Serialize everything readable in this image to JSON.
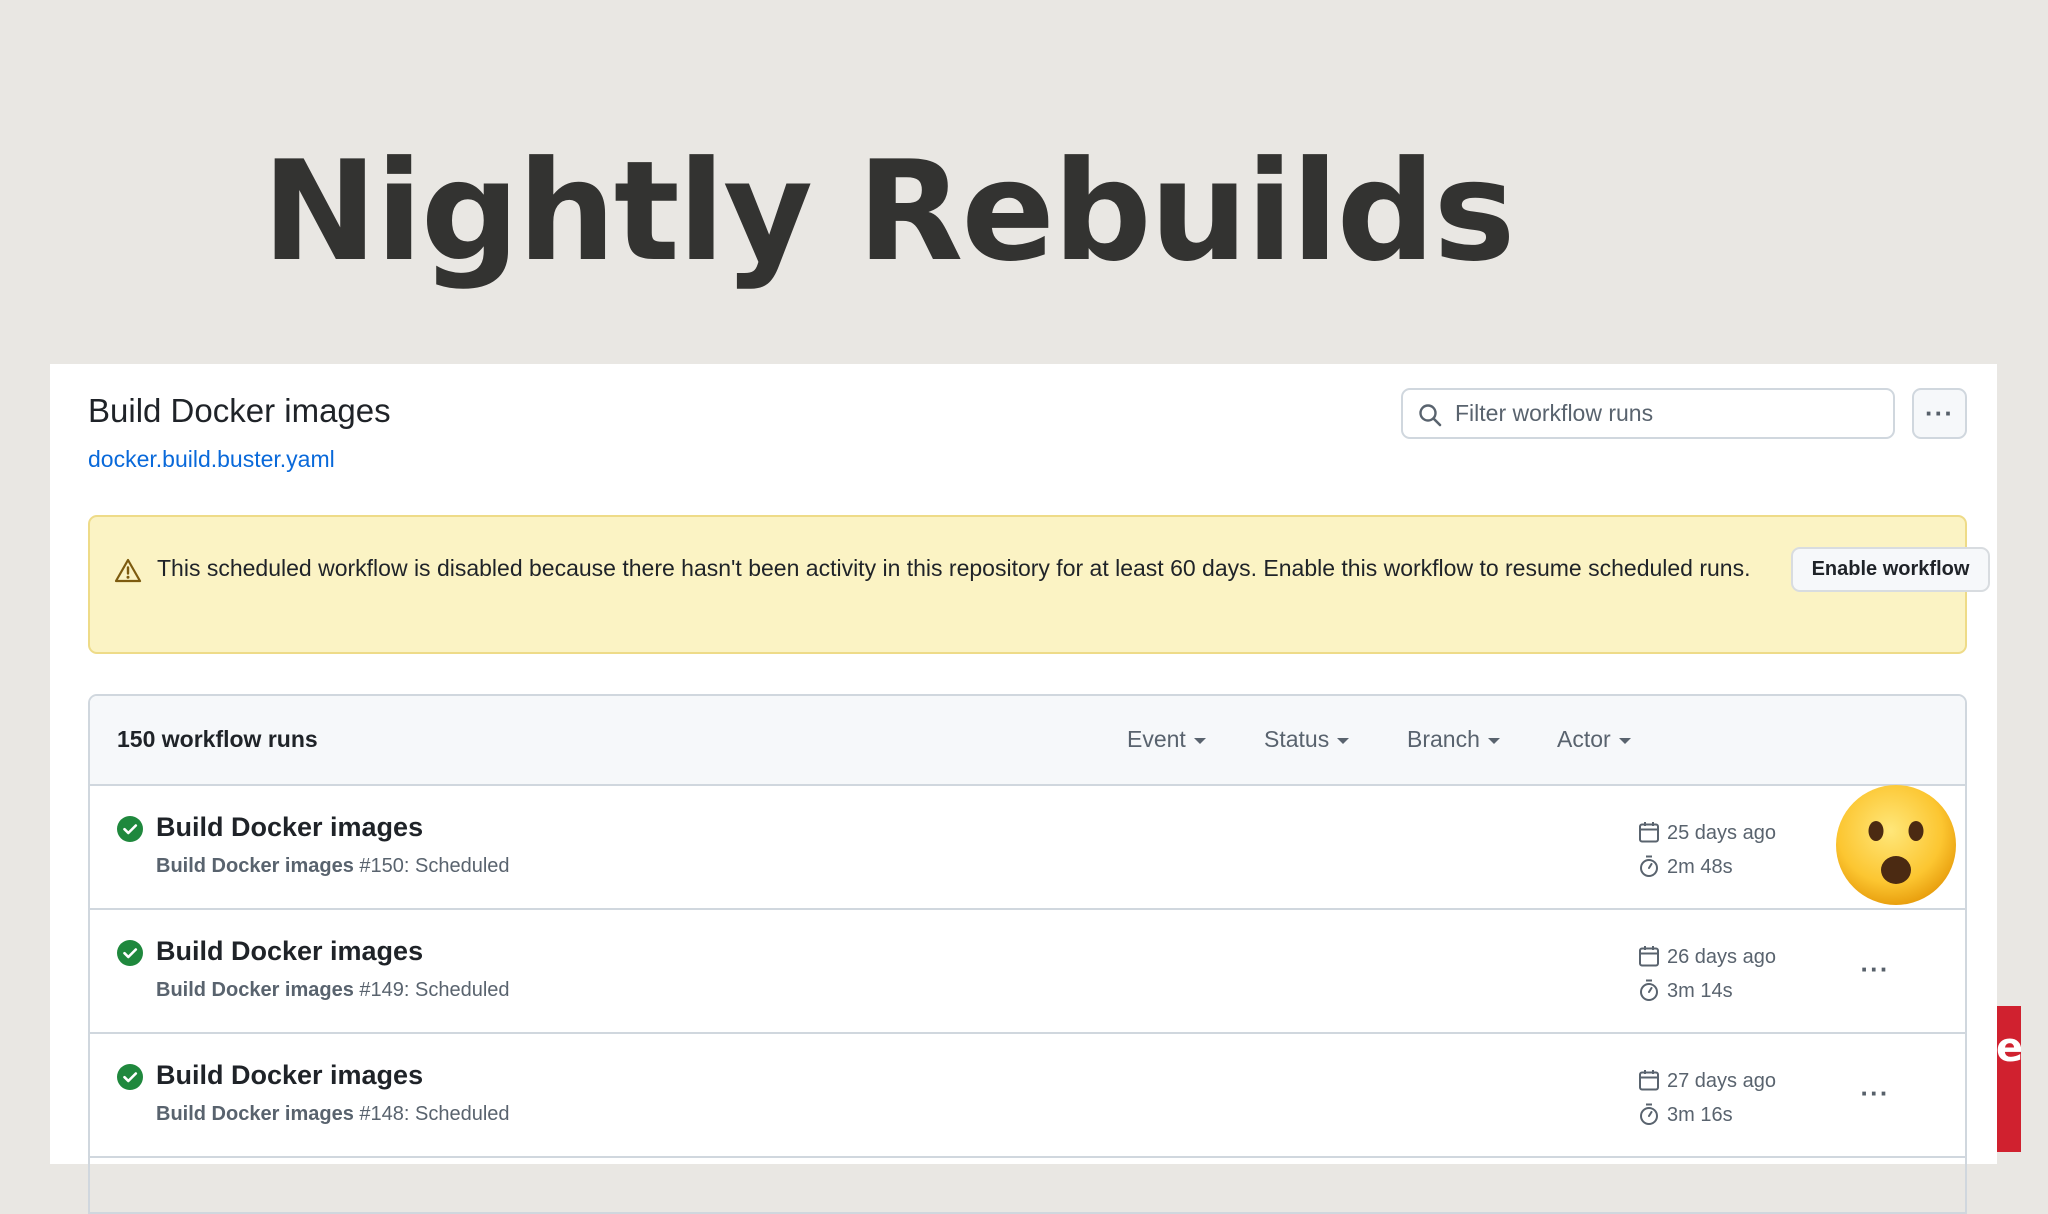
{
  "slide": {
    "title": "Nightly Rebuilds",
    "accent_color": "#d0212f",
    "edge_glyph": "e"
  },
  "workflow": {
    "name": "Build Docker images",
    "file": "docker.build.buster.yaml"
  },
  "search": {
    "placeholder": "Filter workflow runs",
    "value": "",
    "icon": "search-icon"
  },
  "toolbar": {
    "more_label": "···",
    "more_icon": "kebab-horizontal-icon"
  },
  "notice": {
    "icon": "alert-icon",
    "text": "This scheduled workflow is disabled because there hasn't been activity in this repository for at least 60 days. Enable this workflow to resume scheduled runs.",
    "button_label": "Enable workflow",
    "background": "#fbf3c4",
    "border": "#eedb88"
  },
  "runs": {
    "count_label": "150 workflow runs",
    "filters": [
      {
        "label": "Event"
      },
      {
        "label": "Status"
      },
      {
        "label": "Branch"
      },
      {
        "label": "Actor"
      }
    ],
    "items": [
      {
        "status": "success",
        "title": "Build Docker images",
        "workflow": "Build Docker images",
        "detail": " #150: Scheduled",
        "date": "25 days ago",
        "duration": "2m 48s",
        "overlay": "astonished-face-emoji",
        "menu": "···"
      },
      {
        "status": "success",
        "title": "Build Docker images",
        "workflow": "Build Docker images",
        "detail": " #149: Scheduled",
        "date": "26 days ago",
        "duration": "3m 14s",
        "menu": "···"
      },
      {
        "status": "success",
        "title": "Build Docker images",
        "workflow": "Build Docker images",
        "detail": " #148: Scheduled",
        "date": "27 days ago",
        "duration": "3m 16s",
        "menu": "···"
      }
    ]
  },
  "colors": {
    "success": "#1f883d",
    "link": "#0969da",
    "muted_text": "#59636e",
    "page_background": "#e9e7e3"
  }
}
